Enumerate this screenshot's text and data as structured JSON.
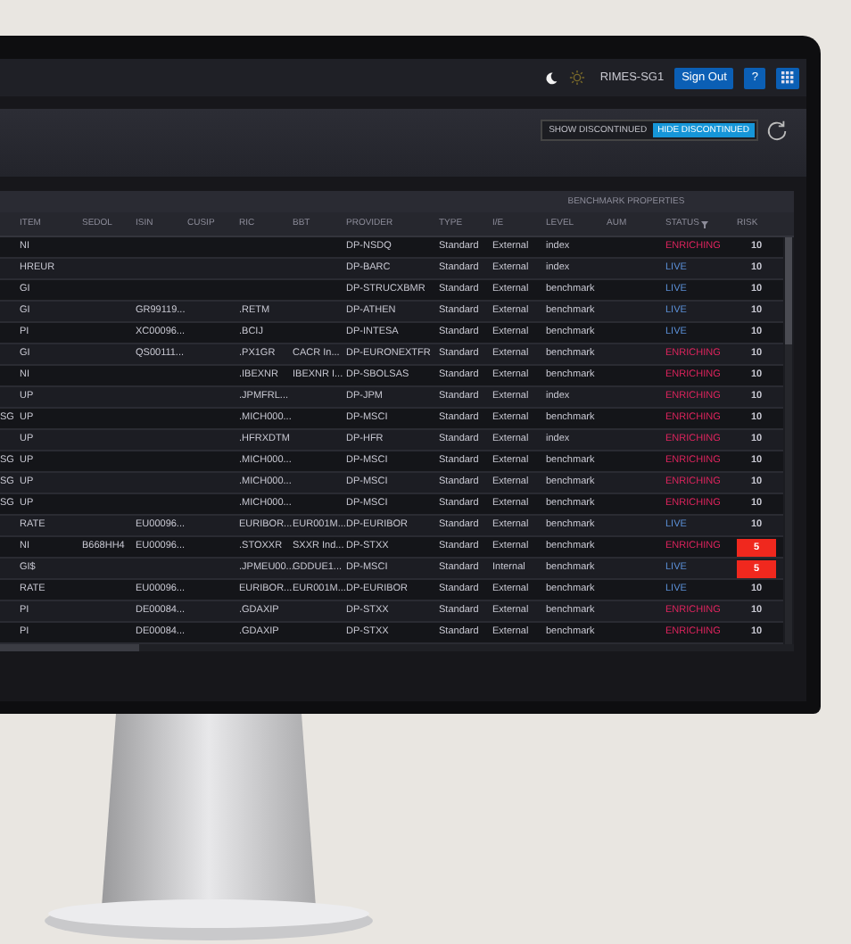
{
  "topbar": {
    "dark_mode": true,
    "user": "RIMES-SG1",
    "sign_out": "Sign Out",
    "help": "?"
  },
  "toolbar": {
    "filter_options": [
      {
        "label": "SHOW DISCONTINUED",
        "selected": false
      },
      {
        "label": "HIDE DISCONTINUED",
        "selected": true
      }
    ]
  },
  "table": {
    "group_header": "BENCHMARK PROPERTIES",
    "columns": [
      "ITEM",
      "SEDOL",
      "ISIN",
      "CUSIP",
      "RIC",
      "BBT",
      "PROVIDER",
      "TYPE",
      "I/E",
      "LEVEL",
      "AUM"
    ],
    "status_column": "STATUS",
    "risk_column": "RISK",
    "rows": [
      {
        "cells": [
          "NI",
          null,
          null,
          null,
          null,
          null,
          "DP-NSDQ",
          "Standard",
          "External",
          "index",
          null
        ],
        "status": {
          "text": "ENRICHING",
          "color": "#e0245e"
        },
        "risk": {
          "text": "10",
          "alert": false
        }
      },
      {
        "cells": [
          "HREUR",
          null,
          null,
          null,
          null,
          null,
          "DP-BARC",
          "Standard",
          "External",
          "index",
          null
        ],
        "status": {
          "text": "LIVE",
          "color": "#5b8fd6"
        },
        "risk": {
          "text": "10",
          "alert": false
        }
      },
      {
        "cells": [
          "GI",
          null,
          null,
          null,
          null,
          null,
          "DP-STRUCXBMR",
          "Standard",
          "External",
          "benchmark",
          null
        ],
        "status": {
          "text": "LIVE",
          "color": "#5b8fd6"
        },
        "risk": {
          "text": "10",
          "alert": false
        }
      },
      {
        "cells": [
          "GI",
          null,
          "GR99119...",
          null,
          ".RETM",
          null,
          "DP-ATHEN",
          "Standard",
          "External",
          "benchmark",
          null
        ],
        "status": {
          "text": "LIVE",
          "color": "#5b8fd6"
        },
        "risk": {
          "text": "10",
          "alert": false
        }
      },
      {
        "cells": [
          "PI",
          null,
          "XC00096...",
          null,
          ".BCIJ",
          null,
          "DP-INTESA",
          "Standard",
          "External",
          "benchmark",
          null
        ],
        "status": {
          "text": "LIVE",
          "color": "#5b8fd6"
        },
        "risk": {
          "text": "10",
          "alert": false
        }
      },
      {
        "cells": [
          "GI",
          null,
          "QS00111...",
          null,
          ".PX1GR",
          "CACR In...",
          "DP-EURONEXTFR",
          "Standard",
          "External",
          "benchmark",
          null
        ],
        "status": {
          "text": "ENRICHING",
          "color": "#e0245e"
        },
        "risk": {
          "text": "10",
          "alert": false
        }
      },
      {
        "cells": [
          "NI",
          null,
          null,
          null,
          ".IBEXNR",
          "IBEXNR I...",
          "DP-SBOLSAS",
          "Standard",
          "External",
          "benchmark",
          null
        ],
        "status": {
          "text": "ENRICHING",
          "color": "#e0245e"
        },
        "risk": {
          "text": "10",
          "alert": false
        }
      },
      {
        "cells": [
          "UP",
          null,
          null,
          null,
          ".JPMFRL...",
          null,
          "DP-JPM",
          "Standard",
          "External",
          "index",
          null
        ],
        "status": {
          "text": "ENRICHING",
          "color": "#e0245e"
        },
        "risk": {
          "text": "10",
          "alert": false
        }
      },
      {
        "column_1": "SG",
        "cells": [
          "UP",
          null,
          null,
          null,
          ".MICH000...",
          null,
          "DP-MSCI",
          "Standard",
          "External",
          "benchmark",
          null
        ],
        "status": {
          "text": "ENRICHING",
          "color": "#e0245e"
        },
        "risk": {
          "text": "10",
          "alert": false
        }
      },
      {
        "cells": [
          "UP",
          null,
          null,
          null,
          ".HFRXDTM",
          null,
          "DP-HFR",
          "Standard",
          "External",
          "index",
          null
        ],
        "status": {
          "text": "ENRICHING",
          "color": "#e0245e"
        },
        "risk": {
          "text": "10",
          "alert": false
        }
      },
      {
        "column_1": "SG",
        "cells": [
          "UP",
          null,
          null,
          null,
          ".MICH000...",
          null,
          "DP-MSCI",
          "Standard",
          "External",
          "benchmark",
          null
        ],
        "status": {
          "text": "ENRICHING",
          "color": "#e0245e"
        },
        "risk": {
          "text": "10",
          "alert": false
        }
      },
      {
        "column_1": "SG",
        "cells": [
          "UP",
          null,
          null,
          null,
          ".MICH000...",
          null,
          "DP-MSCI",
          "Standard",
          "External",
          "benchmark",
          null
        ],
        "status": {
          "text": "ENRICHING",
          "color": "#e0245e"
        },
        "risk": {
          "text": "10",
          "alert": false
        }
      },
      {
        "column_1": "SG",
        "cells": [
          "UP",
          null,
          null,
          null,
          ".MICH000...",
          null,
          "DP-MSCI",
          "Standard",
          "External",
          "benchmark",
          null
        ],
        "status": {
          "text": "ENRICHING",
          "color": "#e0245e"
        },
        "risk": {
          "text": "10",
          "alert": false
        }
      },
      {
        "cells": [
          "RATE",
          null,
          "EU00096...",
          null,
          "EURIBOR...",
          "EUR001M...",
          "DP-EURIBOR",
          "Standard",
          "External",
          "benchmark",
          null
        ],
        "status": {
          "text": "LIVE",
          "color": "#5b8fd6"
        },
        "risk": {
          "text": "10",
          "alert": false
        }
      },
      {
        "cells": [
          "NI",
          "B668HH4",
          "EU00096...",
          null,
          ".STOXXR",
          "SXXR Ind...",
          "DP-STXX",
          "Standard",
          "External",
          "benchmark",
          null
        ],
        "status": {
          "text": "ENRICHING",
          "color": "#e0245e"
        },
        "risk": {
          "text": "5",
          "alert": true
        }
      },
      {
        "cells": [
          "GI$",
          null,
          null,
          null,
          ".JPMEU00...",
          "GDDUE1...",
          "DP-MSCI",
          "Standard",
          "Internal",
          "benchmark",
          null
        ],
        "status": {
          "text": "LIVE",
          "color": "#5b8fd6"
        },
        "risk": {
          "text": "5",
          "alert": true
        }
      },
      {
        "cells": [
          "RATE",
          null,
          "EU00096...",
          null,
          "EURIBOR...",
          "EUR001M...",
          "DP-EURIBOR",
          "Standard",
          "External",
          "benchmark",
          null
        ],
        "status": {
          "text": "LIVE",
          "color": "#5b8fd6"
        },
        "risk": {
          "text": "10",
          "alert": false
        }
      },
      {
        "cells": [
          "PI",
          null,
          "DE00084...",
          null,
          ".GDAXIP",
          null,
          "DP-STXX",
          "Standard",
          "External",
          "benchmark",
          null
        ],
        "status": {
          "text": "ENRICHING",
          "color": "#e0245e"
        },
        "risk": {
          "text": "10",
          "alert": false
        }
      },
      {
        "cells": [
          "PI",
          null,
          "DE00084...",
          null,
          ".GDAXIP",
          null,
          "DP-STXX",
          "Standard",
          "External",
          "benchmark",
          null
        ],
        "status": {
          "text": "ENRICHING",
          "color": "#e0245e"
        },
        "risk": {
          "text": "10",
          "alert": false
        }
      }
    ]
  }
}
